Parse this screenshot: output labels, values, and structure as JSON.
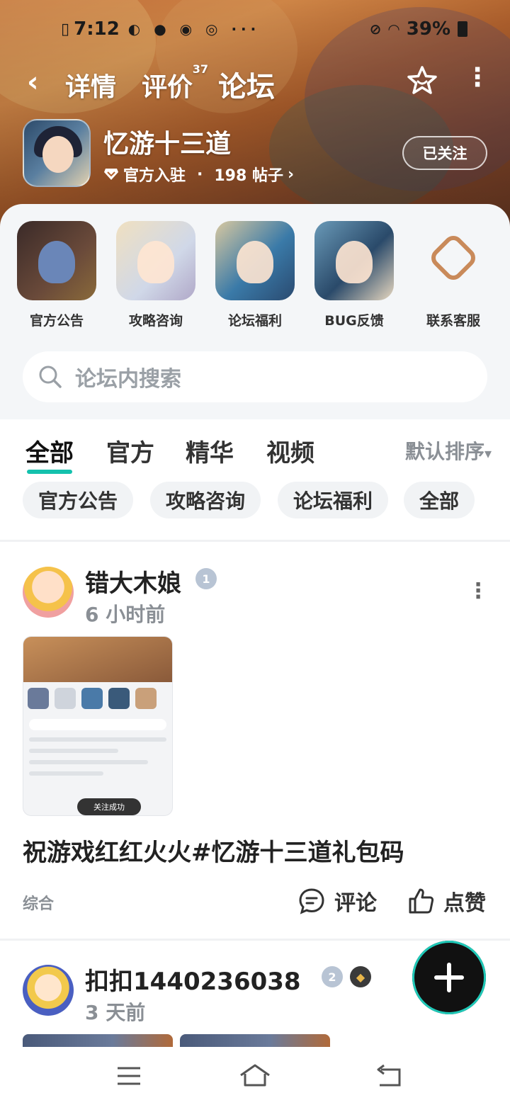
{
  "status_bar": {
    "time": "7:12",
    "battery": "39%",
    "icons": [
      "sim-icon",
      "notification-icons",
      "mute-icon",
      "wifi-icon",
      "battery-icon"
    ]
  },
  "nav": {
    "tabs": [
      {
        "label": "详情"
      },
      {
        "label": "评价",
        "count": "37"
      },
      {
        "label": "论坛",
        "active": true
      }
    ]
  },
  "app": {
    "name": "忆游十三道",
    "official": "官方入驻",
    "separator": "·",
    "posts": "198 帖子",
    "posts_arrow": "›",
    "follow_label": "已关注"
  },
  "boards": [
    {
      "label": "官方公告"
    },
    {
      "label": "攻略咨询"
    },
    {
      "label": "论坛福利"
    },
    {
      "label": "BUG反馈"
    },
    {
      "label": "联系客服"
    }
  ],
  "search": {
    "placeholder": "论坛内搜索"
  },
  "filter_tabs": [
    {
      "label": "全部",
      "active": true
    },
    {
      "label": "官方"
    },
    {
      "label": "精华"
    },
    {
      "label": "视频"
    }
  ],
  "sort_label": "默认排序",
  "sort_arrow": "▾",
  "chips": [
    {
      "label": "官方公告"
    },
    {
      "label": "攻略咨询"
    },
    {
      "label": "论坛福利"
    },
    {
      "label": "全部"
    }
  ],
  "posts": [
    {
      "author": "错大木娘",
      "level": "1",
      "time": "6 小时前",
      "title": "祝游戏红红火火#忆游十三道礼包码",
      "tag": "综合",
      "comment_label": "评论",
      "like_label": "点赞",
      "screenshot_toast": "关注成功"
    },
    {
      "author": "扣扣1440236038",
      "level": "2",
      "time": "3 天前"
    }
  ],
  "colors": {
    "accent": "#14c1ad",
    "fab": "#111111",
    "text_muted": "#8a8f95"
  }
}
